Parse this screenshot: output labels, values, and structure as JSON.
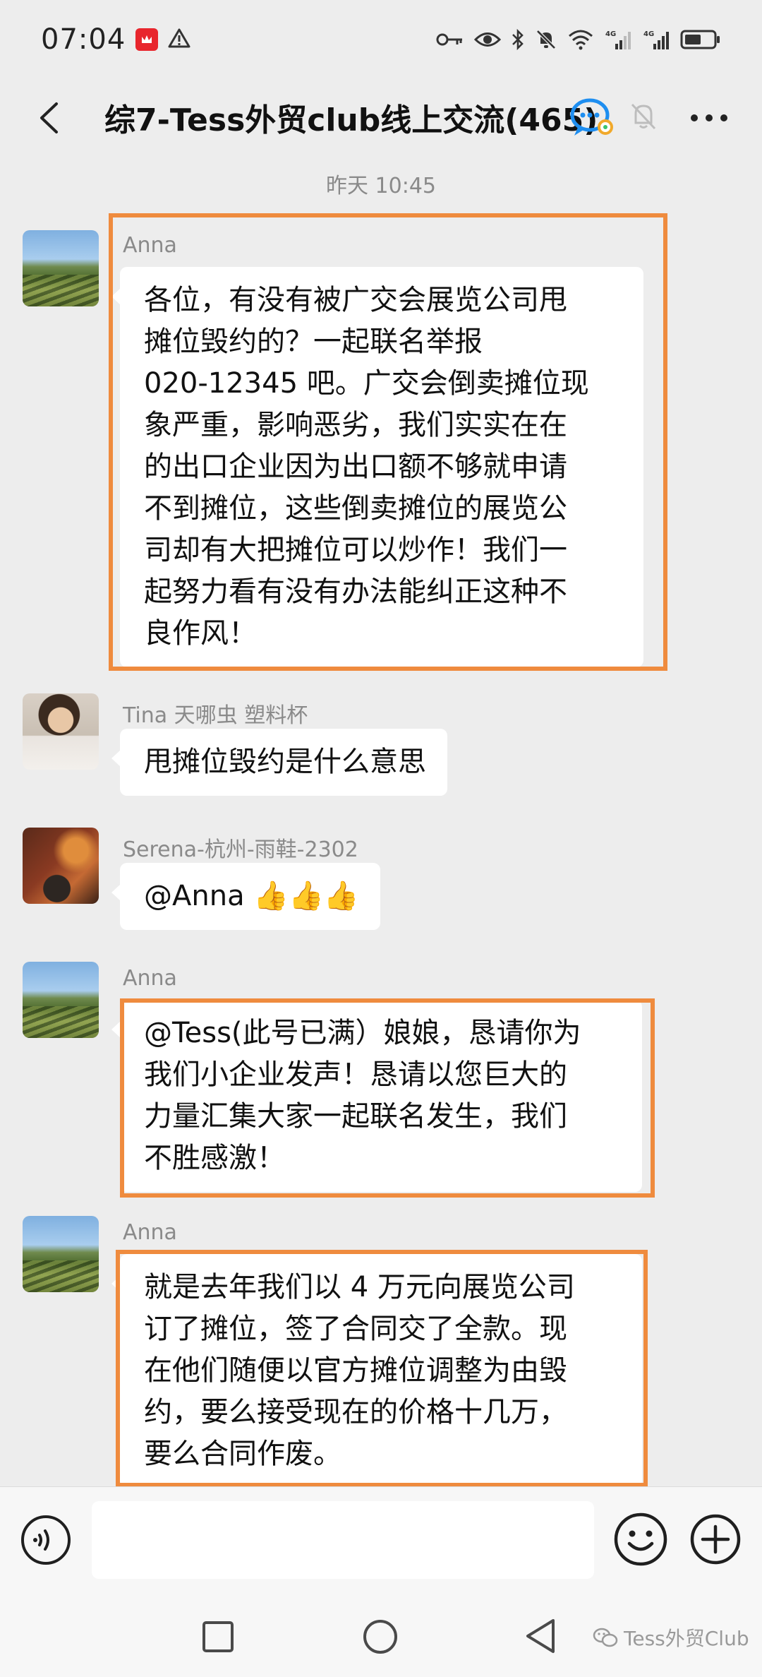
{
  "status_bar": {
    "time": "07:04",
    "net_label_1": "4G",
    "net_label_2": "4G"
  },
  "header": {
    "back_icon": "chevron-left-icon",
    "title": "综7-Tess外贸club线上交流(465)",
    "more_icon": "more-dots-icon"
  },
  "chat": {
    "timestamp": "昨天 10:45",
    "messages": [
      {
        "sender": "Anna",
        "lines": [
          "各位，有没有被广交会展览公司甩",
          "摊位毁约的？一起联名举报",
          "020-12345 吧。广交会倒卖摊位现",
          "象严重，影响恶劣，我们实实在在",
          "的出口企业因为出口额不够就申请",
          "不到摊位，这些倒卖摊位的展览公",
          "司却有大把摊位可以炒作！我们一",
          "起努力看有没有办法能纠正这种不",
          "良作风！"
        ]
      },
      {
        "sender": "Tina 天哪虫 塑料杯",
        "lines": [
          "甩摊位毁约是什么意思"
        ]
      },
      {
        "sender": "Serena-杭州-雨鞋-2302",
        "lines": [
          "@Anna 👍👍👍"
        ]
      },
      {
        "sender": "Anna",
        "lines": [
          "@Tess(此号已满）娘娘，恳请你为",
          "我们小企业发声！恳请以您巨大的",
          "力量汇集大家一起联名发生，我们",
          "不胜感激！"
        ]
      },
      {
        "sender": "Anna",
        "lines": [
          "就是去年我们以 4 万元向展览公司",
          "订了摊位，签了合同交了全款。现",
          "在他们随便以官方摊位调整为由毁",
          "约，要么接受现在的价格十几万，",
          "要么合同作废。"
        ]
      }
    ]
  },
  "input_bar": {
    "placeholder": ""
  },
  "watermark": {
    "text": "Tess外贸Club"
  },
  "colors": {
    "background": "#ededed",
    "bubble": "#ffffff",
    "highlight": "#ef8b3e",
    "timestamp": "#8a8a8a"
  }
}
